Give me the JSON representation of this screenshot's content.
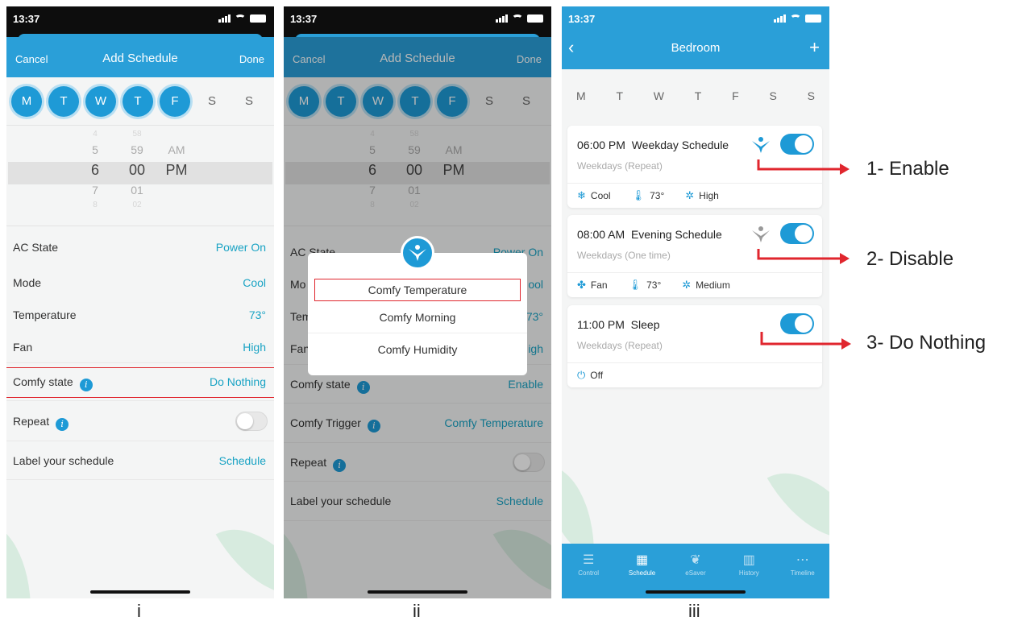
{
  "status_time": "13:37",
  "screen1": {
    "cancel": "Cancel",
    "title": "Add Schedule",
    "done": "Done",
    "days": [
      "M",
      "T",
      "W",
      "T",
      "F",
      "S",
      "S"
    ],
    "picker": {
      "hours": [
        "4",
        "5",
        "6",
        "7",
        "8"
      ],
      "minutes": [
        "58",
        "59",
        "00",
        "01",
        "02"
      ],
      "ampm": [
        "AM",
        "PM"
      ]
    },
    "rows": {
      "ac_state_label": "AC State",
      "ac_state_value": "Power On",
      "mode_label": "Mode",
      "mode_value": "Cool",
      "temperature_label": "Temperature",
      "temperature_value": "73°",
      "fan_label": "Fan",
      "fan_value": "High",
      "comfy_state_label": "Comfy state",
      "comfy_state_value": "Do Nothing",
      "repeat_label": "Repeat",
      "label_label": "Label your schedule",
      "label_value": "Schedule"
    },
    "caption": "i"
  },
  "screen2": {
    "cancel": "Cancel",
    "title": "Add Schedule",
    "done": "Done",
    "days": [
      "M",
      "T",
      "W",
      "T",
      "F",
      "S",
      "S"
    ],
    "picker": {
      "hours": [
        "4",
        "5",
        "6",
        "7",
        "8"
      ],
      "minutes": [
        "58",
        "59",
        "00",
        "01",
        "02"
      ],
      "ampm": [
        "AM",
        "PM"
      ]
    },
    "rows": {
      "ac_state_label": "AC State",
      "ac_state_value": "Power On",
      "mode_label": "Mo",
      "mode_value": "ool",
      "temperature_label": "Tem",
      "temperature_value": "73°",
      "fan_label": "Fan",
      "fan_value": "igh",
      "comfy_state_label": "Comfy state",
      "comfy_state_value": "Enable",
      "comfy_trigger_label": "Comfy Trigger",
      "comfy_trigger_value": "Comfy Temperature",
      "repeat_label": "Repeat",
      "label_label": "Label your schedule",
      "label_value": "Schedule"
    },
    "popup_options": [
      "Comfy Temperature",
      "Comfy Morning",
      "Comfy Humidity"
    ],
    "caption": "ii"
  },
  "screen3": {
    "title": "Bedroom",
    "back": "‹",
    "add": "+",
    "days": [
      "M",
      "T",
      "W",
      "T",
      "F",
      "S",
      "S"
    ],
    "cards": [
      {
        "time": "06:00 PM",
        "name": "Weekday Schedule",
        "repeat": "Weekdays (Repeat)",
        "mode": "Cool",
        "temp": "73°",
        "fan": "High"
      },
      {
        "time": "08:00 AM",
        "name": "Evening Schedule",
        "repeat": "Weekdays (One time)",
        "mode": "Fan",
        "temp": "73°",
        "fan": "Medium"
      },
      {
        "time": "11:00 PM",
        "name": "Sleep",
        "repeat": "Weekdays (Repeat)",
        "mode": "Off"
      }
    ],
    "nav": [
      "Control",
      "Schedule",
      "eSaver",
      "History",
      "Timeline"
    ],
    "caption": "iii"
  },
  "callouts": [
    "1- Enable",
    "2- Disable",
    "3- Do Nothing"
  ],
  "colors": {
    "accent": "#2a9fd8",
    "value_text": "#1aa3c4",
    "highlight_box": "#e0262e"
  }
}
